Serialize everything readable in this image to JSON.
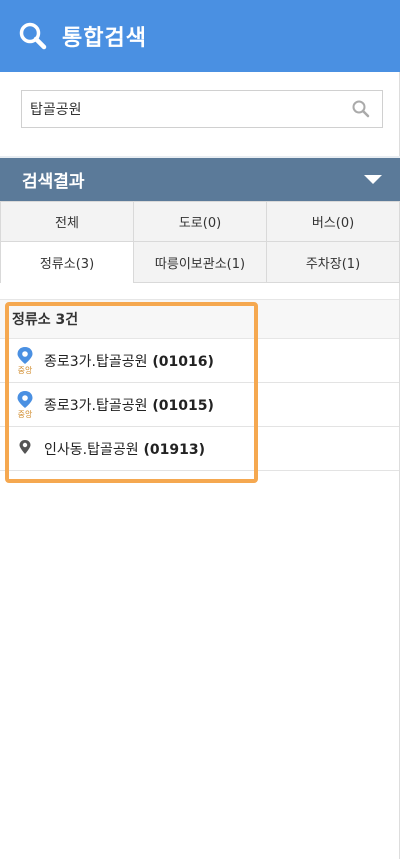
{
  "header": {
    "title": "통합검색",
    "icon": "search-icon"
  },
  "search": {
    "value": "탑골공원",
    "icon": "magnifier-icon"
  },
  "results_bar": {
    "title": "검색결과",
    "icon": "caret-down-icon"
  },
  "tabs": {
    "row1": [
      {
        "label": "전체",
        "active": false
      },
      {
        "label": "도로(0)",
        "active": false
      },
      {
        "label": "버스(0)",
        "active": false
      }
    ],
    "row2": [
      {
        "label": "정류소(3)",
        "active": true
      },
      {
        "label": "따릉이보관소(1)",
        "active": false
      },
      {
        "label": "주차장(1)",
        "active": false
      }
    ]
  },
  "stop_list": {
    "header": "정류소 3건",
    "items": [
      {
        "name": "종로3가.탑골공원",
        "code": "(01016)",
        "icon": "central-bus-stop-pin-icon",
        "badge": "중앙"
      },
      {
        "name": "종로3가.탑골공원",
        "code": "(01015)",
        "icon": "central-bus-stop-pin-icon",
        "badge": "중앙"
      },
      {
        "name": "인사동.탑골공원",
        "code": "(01913)",
        "icon": "bus-stop-pin-icon"
      }
    ]
  },
  "colors": {
    "header_bg": "#4a90e2",
    "results_bar_bg": "#5b7a99",
    "highlight": "#f5a850",
    "pin_blue": "#4a90e2",
    "pin_dark": "#555555"
  }
}
